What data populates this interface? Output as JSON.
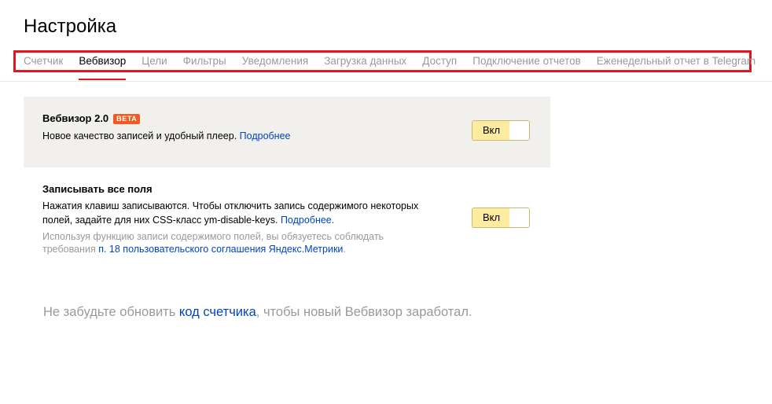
{
  "page": {
    "title": "Настройка"
  },
  "tabs": [
    {
      "label": "Счетчик",
      "active": false
    },
    {
      "label": "Вебвизор",
      "active": true
    },
    {
      "label": "Цели",
      "active": false
    },
    {
      "label": "Фильтры",
      "active": false
    },
    {
      "label": "Уведомления",
      "active": false
    },
    {
      "label": "Загрузка данных",
      "active": false
    },
    {
      "label": "Доступ",
      "active": false
    },
    {
      "label": "Подключение отчетов",
      "active": false
    },
    {
      "label": "Еженедельный отчет в Telegram",
      "active": false
    }
  ],
  "webvisor2": {
    "title": "Вебвизор 2.0",
    "badge": "BETA",
    "description": "Новое качество записей и удобный плеер.",
    "more_link": "Подробнее",
    "toggle_label": "Вкл",
    "toggle_on": true
  },
  "record_fields": {
    "title": "Записывать все поля",
    "description_line1": "Нажатия клавиш записываются. Чтобы отключить запись содержимого некоторых",
    "description_line2": "полей, задайте для них CSS-класс ym-disable-keys.",
    "more_link": "Подробнее.",
    "hint_line1": "Используя функцию записи содержимого полей, вы обязуетесь соблюдать",
    "hint_line2_prefix": "требования",
    "hint_link": "п. 18 пользовательского соглашения Яндекс.Метрики",
    "hint_suffix": ".",
    "toggle_label": "Вкл",
    "toggle_on": true
  },
  "reminder": {
    "prefix": "Не забудьте обновить",
    "link": "код счетчика",
    "suffix": ", чтобы новый Вебвизор заработал."
  },
  "colors": {
    "accent_red": "#e8141d",
    "badge_orange": "#f15a22",
    "link_blue": "#0044bb",
    "toggle_yellow": "#ffeba0",
    "panel_bg": "#f2f0ed"
  }
}
